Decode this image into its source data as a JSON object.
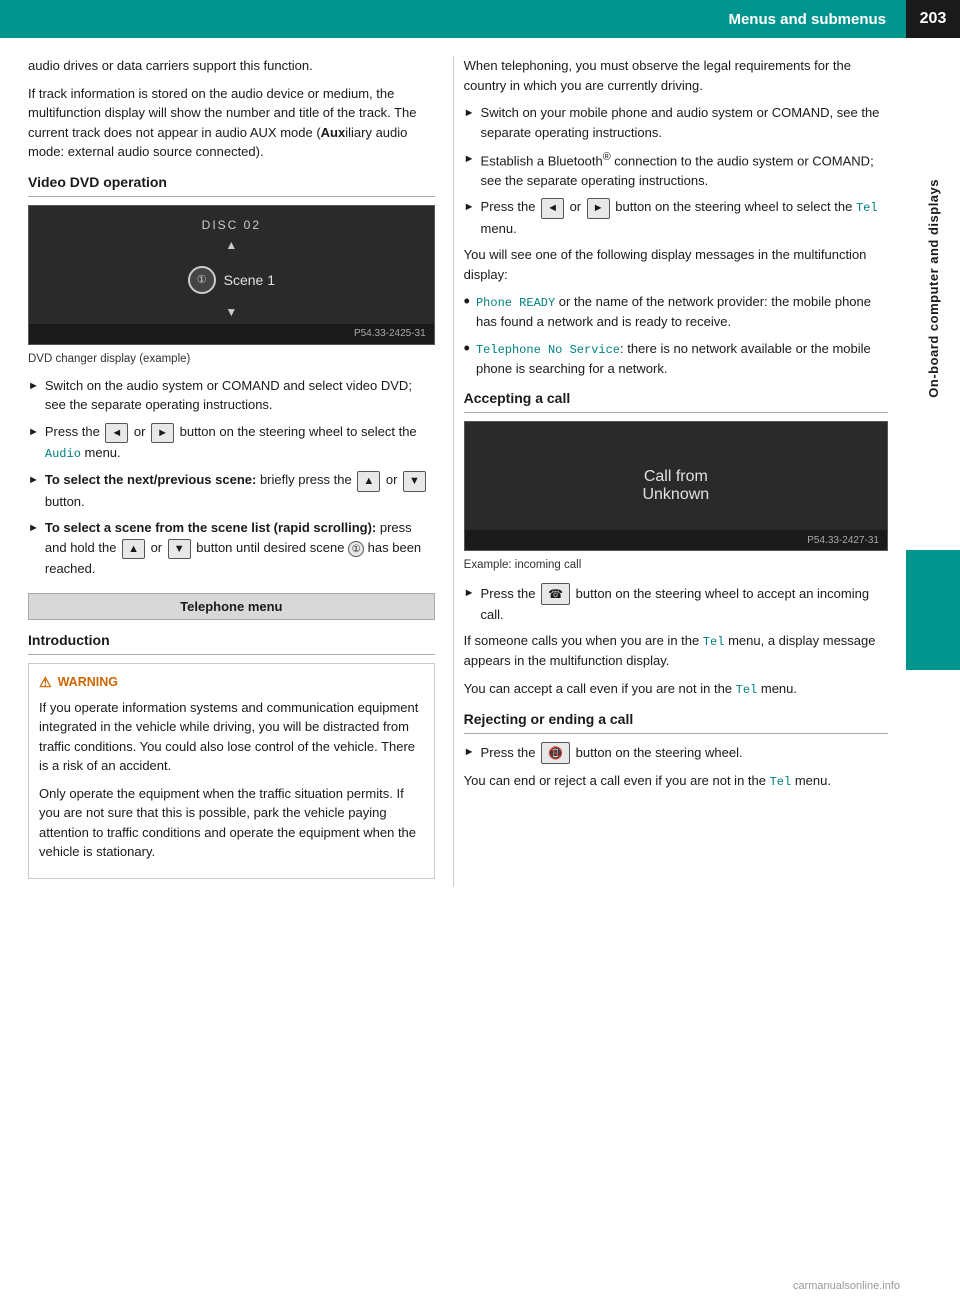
{
  "header": {
    "title": "Menus and submenus",
    "page_number": "203"
  },
  "sidebar": {
    "label": "On-board computer and displays"
  },
  "left_column": {
    "intro_text_1": "audio drives or data carriers support this function.",
    "intro_text_2": "If track information is stored on the audio device or medium, the multifunction display will show the number and title of the track. The current track does not appear in audio AUX mode (Auxiliary audio mode: external audio source connected).",
    "video_dvd": {
      "heading": "Video DVD operation",
      "dvd_label": "DISC 02",
      "dvd_scene": "Scene 1",
      "dvd_watermark": "P54.33-2425-31",
      "caption": "DVD changer display (example)",
      "bullets": [
        {
          "text": "Switch on the audio system or COMAND and select video DVD; see the separate operating instructions."
        },
        {
          "text_parts": [
            "Press the ",
            "◄",
            " or ",
            "►",
            " button on the steering wheel to select the ",
            "Audio",
            " menu."
          ],
          "has_mono": true,
          "mono_word": "Audio"
        },
        {
          "bold_prefix": "To select the next/previous scene:",
          "text": " briefly press the ",
          "btn1": "▲",
          "mid": " or ",
          "btn2": "▼",
          "suffix": " button."
        },
        {
          "bold_prefix": "To select a scene from the scene list (rapid scrolling):",
          "text": " press and hold the ",
          "btn1": "▲",
          "mid": " or ",
          "btn2": "▼",
          "suffix": " button until desired scene ",
          "circle": "1",
          "end": " has been reached."
        }
      ]
    },
    "telephone_menu": {
      "box_label": "Telephone menu",
      "intro_heading": "Introduction",
      "warning": {
        "title": "WARNING",
        "text_1": "If you operate information systems and communication equipment integrated in the vehicle while driving, you will be distracted from traffic conditions. You could also lose control of the vehicle. There is a risk of an accident.",
        "text_2": "Only operate the equipment when the traffic situation permits. If you are not sure that this is possible, park the vehicle paying attention to traffic conditions and operate the equipment when the vehicle is stationary."
      }
    }
  },
  "right_column": {
    "intro_text_1": "When telephoning, you must observe the legal requirements for the country in which you are currently driving.",
    "bullets": [
      {
        "text": "Switch on your mobile phone and audio system or COMAND, see the separate operating instructions."
      },
      {
        "text": "Establish a Bluetooth® connection to the audio system or COMAND; see the separate operating instructions."
      },
      {
        "text_parts": [
          "Press the ",
          "◄",
          " or ",
          "►",
          " button on the steering wheel to select the ",
          "Tel",
          " menu."
        ],
        "mono_word": "Tel"
      }
    ],
    "display_msg_intro": "You will see one of the following display messages in the multifunction display:",
    "dot_items": [
      {
        "text_prefix": "Phone READY",
        "text_color": "teal",
        "text_suffix": " or the name of the network provider: the mobile phone has found a network and is ready to receive."
      },
      {
        "text_prefix": "Telephone No Service",
        "text_color": "teal",
        "text_suffix": ": there is no network available or the mobile phone is searching for a network."
      }
    ],
    "accepting_call": {
      "heading": "Accepting a call",
      "call_display_line1": "Call from",
      "call_display_line2": "Unknown",
      "call_watermark": "P54.33-2427-31",
      "caption": "Example: incoming call",
      "bullet_accept": "Press the  button on the steering wheel to accept an incoming call.",
      "text_1_prefix": "If someone calls you when you are in the ",
      "text_1_mono": "Tel",
      "text_1_suffix": " menu, a display message appears in the multifunction display.",
      "text_2": "You can accept a call even if you are not in the ",
      "text_2_mono": "Tel",
      "text_2_suffix": " menu."
    },
    "rejecting_call": {
      "heading": "Rejecting or ending a call",
      "bullet_reject": "Press the  button on the steering wheel.",
      "text_1": "You can end or reject a call even if you are not in the ",
      "text_1_mono": "Tel",
      "text_1_suffix": " menu."
    }
  },
  "watermark": "carmanualsonline.info"
}
